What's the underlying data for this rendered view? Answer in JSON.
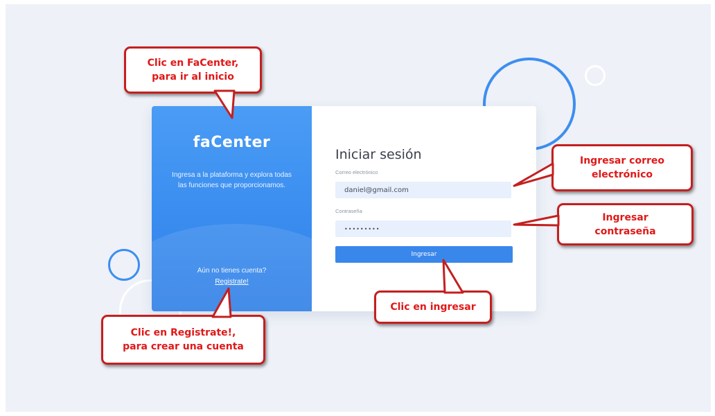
{
  "brand": "faCenter",
  "tagline": "Ingresa a la plataforma y explora todas las funciones que proporcionamos.",
  "no_account": "Aún no tienes cuenta?",
  "register_link": "Registrate!",
  "login": {
    "title": "Iniciar sesión",
    "email_label": "Correo electrónico",
    "email_value": "daniel@gmail.com",
    "password_label": "Contraseña",
    "password_value": "•••••••••",
    "submit_label": "Ingresar"
  },
  "callouts": {
    "facenter": [
      "Clic en FaCenter,",
      "para ir al inicio"
    ],
    "email": [
      "Ingresar correo",
      "electrónico"
    ],
    "password": [
      "Ingresar",
      "contraseña"
    ],
    "ingresar": [
      "Clic en ingresar"
    ],
    "register": [
      "Clic en Registrate!,",
      "para crear una cuenta"
    ]
  },
  "colors": {
    "primary": "#3a87ec",
    "callout_text": "#e01818",
    "callout_border": "#c41f1f",
    "input_bg": "#e8f0fd"
  }
}
